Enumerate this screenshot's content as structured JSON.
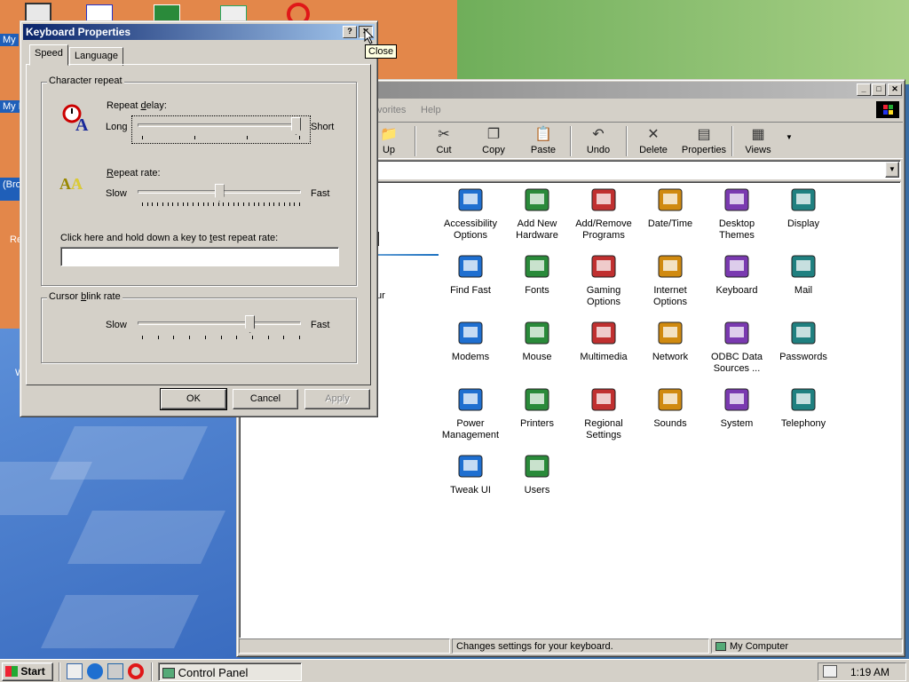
{
  "desktop": {
    "icon_labels": [
      "My",
      "My D",
      "(Bro",
      "Re",
      "W"
    ]
  },
  "control_panel": {
    "menu": [
      "vorites",
      "Help"
    ],
    "toolbar": [
      {
        "label": "Up",
        "icon": "up-folder-icon"
      },
      {
        "label": "Cut",
        "icon": "scissors-icon"
      },
      {
        "label": "Copy",
        "icon": "copy-icon"
      },
      {
        "label": "Paste",
        "icon": "paste-icon"
      },
      {
        "label": "Undo",
        "icon": "undo-icon"
      },
      {
        "label": "Delete",
        "icon": "delete-icon"
      },
      {
        "label": "Properties",
        "icon": "properties-icon"
      },
      {
        "label": "Views",
        "icon": "views-icon"
      }
    ],
    "heading_fragment": "el",
    "side_text_fragment": "ur",
    "items": [
      {
        "label": "Accessibility Options",
        "icon": "accessibility-icon"
      },
      {
        "label": "Add New Hardware",
        "icon": "hardware-icon"
      },
      {
        "label": "Add/Remove Programs",
        "icon": "programs-icon"
      },
      {
        "label": "Date/Time",
        "icon": "calendar-clock-icon"
      },
      {
        "label": "Desktop Themes",
        "icon": "themes-icon"
      },
      {
        "label": "Display",
        "icon": "display-icon"
      },
      {
        "label": "Find Fast",
        "icon": "binoculars-icon"
      },
      {
        "label": "Fonts",
        "icon": "fonts-folder-icon"
      },
      {
        "label": "Gaming Options",
        "icon": "joystick-icon"
      },
      {
        "label": "Internet Options",
        "icon": "globe-icon"
      },
      {
        "label": "Keyboard",
        "icon": "keyboard-icon"
      },
      {
        "label": "Mail",
        "icon": "mail-icon"
      },
      {
        "label": "Modems",
        "icon": "modem-icon"
      },
      {
        "label": "Mouse",
        "icon": "mouse-icon"
      },
      {
        "label": "Multimedia",
        "icon": "multimedia-icon"
      },
      {
        "label": "Network",
        "icon": "network-icon"
      },
      {
        "label": "ODBC Data Sources ...",
        "icon": "odbc-icon"
      },
      {
        "label": "Passwords",
        "icon": "keys-icon"
      },
      {
        "label": "Power Management",
        "icon": "power-icon"
      },
      {
        "label": "Printers",
        "icon": "printers-folder-icon"
      },
      {
        "label": "Regional Settings",
        "icon": "globe-icon"
      },
      {
        "label": "Sounds",
        "icon": "speaker-icon"
      },
      {
        "label": "System",
        "icon": "computer-icon"
      },
      {
        "label": "Telephony",
        "icon": "telephone-icon"
      },
      {
        "label": "Tweak UI",
        "icon": "tweakui-icon"
      },
      {
        "label": "Users",
        "icon": "users-icon"
      }
    ],
    "status_text": "Changes settings for your keyboard.",
    "status_location": "My Computer"
  },
  "keyboard_dialog": {
    "title": "Keyboard Properties",
    "help_glyph": "?",
    "close_glyph": "✕",
    "tooltip": "Close",
    "tabs": [
      "Speed",
      "Language"
    ],
    "character_repeat": {
      "group_label": "Character repeat",
      "repeat_delay": {
        "label_pre": "Repeat ",
        "label_key": "d",
        "label_post": "elay:",
        "min_label": "Long",
        "max_label": "Short",
        "value_fraction": 1.0,
        "ticks": 4
      },
      "repeat_rate": {
        "label_pre": "",
        "label_key": "R",
        "label_post": "epeat rate:",
        "min_label": "Slow",
        "max_label": "Fast",
        "value_fraction": 0.5,
        "ticks": 32
      },
      "test_label_pre": "Click here and hold down a key to ",
      "test_label_key": "t",
      "test_label_post": "est repeat rate:",
      "test_value": ""
    },
    "cursor_blink": {
      "group_label_pre": "Cursor ",
      "group_label_key": "b",
      "group_label_post": "link rate",
      "min_label": "Slow",
      "max_label": "Fast",
      "value_fraction": 0.7,
      "ticks": 11
    },
    "buttons": {
      "ok": "OK",
      "cancel": "Cancel",
      "apply": "Apply"
    }
  },
  "taskbar": {
    "start_label": "Start",
    "task_label": "Control Panel",
    "clock": "1:19 AM"
  }
}
